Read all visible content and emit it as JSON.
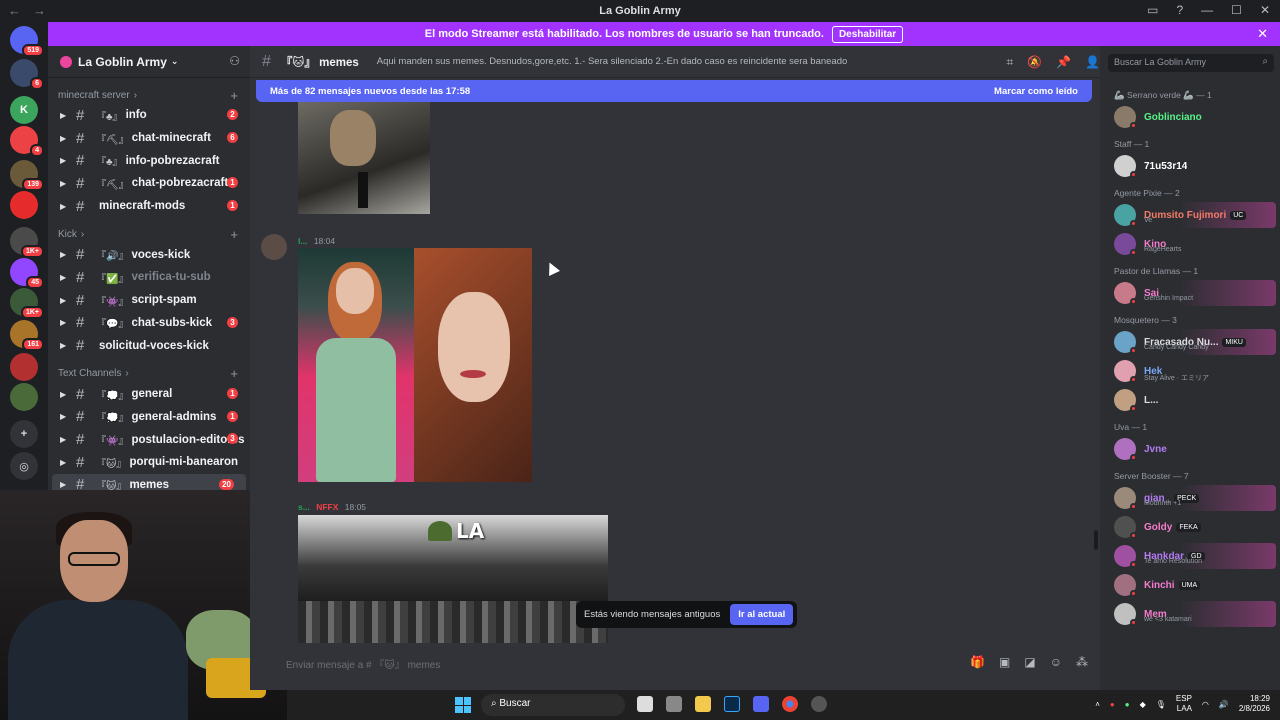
{
  "window": {
    "title": "La Goblin Army"
  },
  "banner": {
    "message": "El modo Streamer está habilitado. Los nombres de usuario se han truncado.",
    "button": "Deshabilitar"
  },
  "rail": {
    "servers": [
      {
        "badge": "519",
        "color": "#5865f2"
      },
      {
        "badge": "6",
        "color": "#3a4a6b"
      },
      {
        "badge": "",
        "color": "#3ba55d",
        "label": "K"
      },
      {
        "badge": "4",
        "color": "#ed4245"
      },
      {
        "badge": "139",
        "color": "#6b5a3a"
      },
      {
        "badge": "",
        "color": "#e52b2b"
      },
      {
        "badge": "1K+",
        "color": "#4a4a4a"
      },
      {
        "badge": "45",
        "color": "#9146ff"
      },
      {
        "badge": "1K+",
        "color": "#3a5a3a"
      },
      {
        "badge": "161",
        "color": "#a8742a"
      },
      {
        "badge": "",
        "color": "#b33030"
      },
      {
        "badge": "",
        "color": "#4a6a3a"
      }
    ]
  },
  "sidebar": {
    "server_name": "La Goblin Army",
    "categories": [
      {
        "name": "minecraft server",
        "channels": [
          {
            "emoji": "『♣』",
            "name": "info",
            "badge": "2"
          },
          {
            "emoji": "『⛏』",
            "name": "chat-minecraft",
            "badge": "6"
          },
          {
            "emoji": "『♣』",
            "name": "info-pobrezacraft",
            "badge": ""
          },
          {
            "emoji": "『⛏』",
            "name": "chat-pobrezacraft",
            "badge": "1"
          },
          {
            "emoji": "",
            "name": "minecraft-mods",
            "badge": "1"
          }
        ]
      },
      {
        "name": "Kick",
        "channels": [
          {
            "emoji": "『🔊』",
            "name": "voces-kick",
            "badge": ""
          },
          {
            "emoji": "『✅』",
            "name": "verifica-tu-sub",
            "badge": ""
          },
          {
            "emoji": "『👾』",
            "name": "script-spam",
            "badge": ""
          },
          {
            "emoji": "『💬』",
            "name": "chat-subs-kick",
            "badge": "3"
          },
          {
            "emoji": "",
            "name": "solicitud-voces-kick",
            "badge": ""
          }
        ]
      },
      {
        "name": "Text Channels",
        "channels": [
          {
            "emoji": "『💭』",
            "name": "general",
            "badge": "1"
          },
          {
            "emoji": "『💭』",
            "name": "general-admins",
            "badge": "1"
          },
          {
            "emoji": "『👾』",
            "name": "postulacion-editores",
            "badge": "3"
          },
          {
            "emoji": "『🐱』",
            "name": "porqui-mi-banearon",
            "badge": ""
          },
          {
            "emoji": "『🐱』",
            "name": "memes",
            "badge": "20"
          }
        ]
      }
    ]
  },
  "chat": {
    "channel_name": "memes",
    "channel_emoji": "『🐱』",
    "topic": "Aqui manden sus memes. Desnudos,gore,etc. 1.- Sera silenciado 2.-En dado caso es reincidente sera baneado",
    "new_messages_bar": "Más de 82 mensajes nuevos desde las 17:58",
    "mark_read": "Marcar como leído",
    "messages": [
      {
        "author": "l...",
        "time": "18:04"
      },
      {
        "author": "s...",
        "tag": "NFFX",
        "time": "18:05"
      }
    ],
    "meme_text": "LA",
    "old_messages_notice": "Estás viendo mensajes antiguos",
    "jump_button": "Ir al actual",
    "composer_placeholder": "Enviar mensaje a # 『🐱』 memes"
  },
  "members": {
    "search_placeholder": "Buscar La Goblin Army",
    "groups": [
      {
        "role": "🦾 Serrano verde 🦾 — 1",
        "members": [
          {
            "name": "Goblinciano",
            "color": "#57f287",
            "sub": ""
          }
        ]
      },
      {
        "role": "Staff — 1",
        "members": [
          {
            "name": "71u53r14",
            "color": "#ffffff",
            "sub": ""
          }
        ]
      },
      {
        "role": "Agente Pixie — 2",
        "members": [
          {
            "name": "Dumsito Fujimori",
            "color": "#f47b67",
            "sub": "Ve",
            "tag": "UC"
          },
          {
            "name": "Kino",
            "color": "#f47bcd",
            "sub": "RageHearts"
          }
        ]
      },
      {
        "role": "Pastor de Llamas — 1",
        "members": [
          {
            "name": "Sai",
            "color": "#f47bcd",
            "sub": "Genshin Impact"
          }
        ]
      },
      {
        "role": "Mosquetero — 3",
        "members": [
          {
            "name": "Fracasado Nu...",
            "color": "#dbdee1",
            "sub": "Candy Candy Candy",
            "tag": "MIKU"
          },
          {
            "name": "Hek",
            "color": "#7aa7f4",
            "sub": "Stay Alive · エミリア"
          },
          {
            "name": "L...",
            "color": "#dbdee1",
            "sub": ""
          }
        ]
      },
      {
        "role": "Uva — 1",
        "members": [
          {
            "name": "Jvne",
            "color": "#b57bf4",
            "sub": ""
          }
        ]
      },
      {
        "role": "Server Booster — 7",
        "members": [
          {
            "name": "gian_",
            "color": "#b57bf4",
            "sub": "Modrinth +1",
            "tag": "PECK"
          },
          {
            "name": "Goldy",
            "color": "#f47bcd",
            "sub": "",
            "tag": "FEKA"
          },
          {
            "name": "Hankdar",
            "color": "#b57bf4",
            "sub": "Te amo Resolution",
            "tag": "GD"
          },
          {
            "name": "Kinchi",
            "color": "#f47bcd",
            "sub": "",
            "tag": "UMA"
          },
          {
            "name": "Mem",
            "color": "#f47bcd",
            "sub": "we <3 katamari"
          }
        ]
      }
    ]
  },
  "taskbar": {
    "search_label": "Buscar",
    "lang": "ESP",
    "lang2": "LAA",
    "time": "18:29",
    "date": "2/8/2026"
  }
}
